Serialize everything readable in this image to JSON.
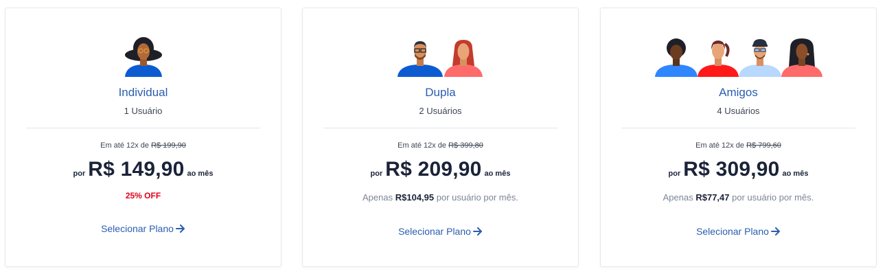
{
  "plans": [
    {
      "name": "Individual",
      "users": "1 Usuário",
      "installments_prefix": "Em até 12x de",
      "old_price": "R$ 199,90",
      "price_prefix": "por",
      "price": "R$ 149,90",
      "price_suffix": "ao mês",
      "discount": "25% OFF",
      "cta": "Selecionar Plano"
    },
    {
      "name": "Dupla",
      "users": "2 Usuários",
      "installments_prefix": "Em até 12x de",
      "old_price": "R$ 399,80",
      "price_prefix": "por",
      "price": "R$ 209,90",
      "price_suffix": "ao mês",
      "per_user_prefix": "Apenas",
      "per_user_value": "R$104,95",
      "per_user_suffix": "por usuário por mês.",
      "cta": "Selecionar Plano"
    },
    {
      "name": "Amigos",
      "users": "4 Usuários",
      "installments_prefix": "Em até 12x de",
      "old_price": "R$ 799,60",
      "price_prefix": "por",
      "price": "R$ 309,90",
      "price_suffix": "ao mês",
      "per_user_prefix": "Apenas",
      "per_user_value": "R$77,47",
      "per_user_suffix": "por usuário por mês.",
      "cta": "Selecionar Plano"
    }
  ],
  "colors": {
    "accent": "#2a5db0",
    "discount": "#e0001b",
    "price": "#1a2338"
  },
  "icons": {
    "cta_arrow": "arrow-right-icon"
  }
}
